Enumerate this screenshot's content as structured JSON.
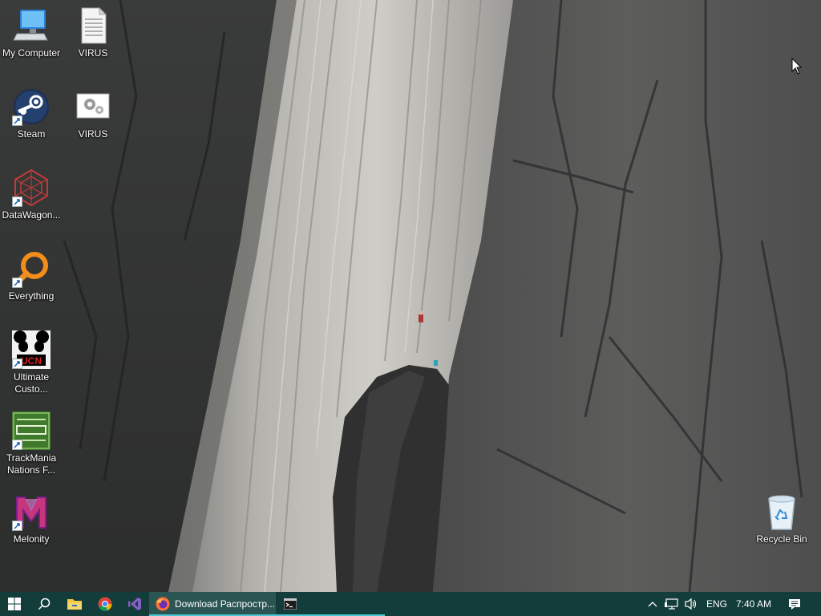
{
  "desktop": {
    "icons": [
      {
        "label": "My Computer",
        "icon": "my-computer-icon"
      },
      {
        "label": "VIRUS",
        "icon": "text-file-icon"
      },
      {
        "label": "Steam",
        "icon": "steam-icon"
      },
      {
        "label": "VIRUS",
        "icon": "settings-file-icon"
      },
      {
        "label": "DataWagon...",
        "icon": "datawagon-icon"
      },
      {
        "label": "Everything",
        "icon": "everything-search-icon"
      },
      {
        "label": "Ultimate Custo...",
        "icon": "ucn-icon"
      },
      {
        "label": "TrackMania Nations F...",
        "icon": "trackmania-icon"
      },
      {
        "label": "Melonity",
        "icon": "melonity-icon"
      },
      {
        "label": "Recycle Bin",
        "icon": "recycle-bin-icon"
      }
    ]
  },
  "taskbar": {
    "active_task": {
      "label": "Download Распростр...",
      "icon": "firefox-icon"
    },
    "language": "ENG",
    "time": "7:40 AM",
    "pinned_icons": [
      "windows-start-icon",
      "search-icon",
      "file-explorer-icon",
      "chrome-icon",
      "visual-studio-icon",
      "firefox-icon",
      "command-prompt-icon"
    ],
    "tray_icons": [
      "chevron-up-icon",
      "network-icon",
      "volume-icon",
      "notification-icon"
    ]
  },
  "colors": {
    "taskbar_bg": "#123d3a",
    "taskbar_active": "#2a5553",
    "taskbar_accent": "#4ec7d4"
  }
}
